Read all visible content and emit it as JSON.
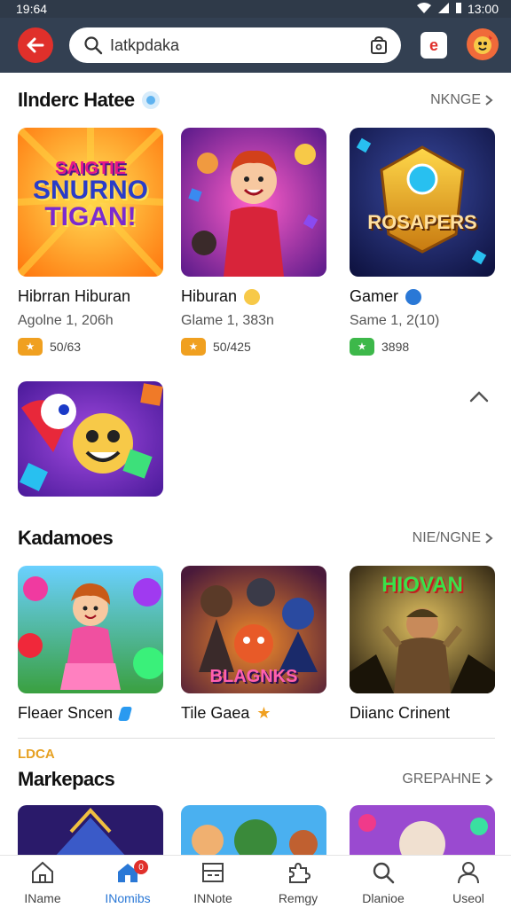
{
  "status_bar": {
    "time_left": "19:64",
    "time_right": "13:00"
  },
  "top_bar": {
    "search_value": "Iatkpdaka",
    "search_placeholder": "Iatkpdaka",
    "notification_label": "e"
  },
  "sections": [
    {
      "title": "Ilnderc Hatee",
      "more_label": "NKNGE",
      "cards": [
        {
          "title": "Hibrran Hiburan",
          "subtitle": "Agolne 1, 206h",
          "badge_text": "50/63",
          "badge_color": "#f0a020",
          "thumb_label_1": "SAIGTIE",
          "thumb_label_2": "SNURNO",
          "thumb_label_3": "TIGAN!"
        },
        {
          "title": "Hiburan",
          "subtitle": "Glame 1, 383n",
          "badge_text": "50/425",
          "badge_color": "#f0a020"
        },
        {
          "title": "Gamer",
          "subtitle": "Same 1, 2(10)",
          "badge_text": "3898",
          "badge_color": "#3db84a",
          "thumb_label_1": "ROSAPERS"
        }
      ]
    },
    {
      "title": "Kadamoes",
      "more_label": "NIE/NGNE",
      "cards": [
        {
          "title": "Fleaer Sncen"
        },
        {
          "title": "Tile Gaea",
          "thumb_label_1": "BLAGNKS"
        },
        {
          "title": "Diianc Crinent",
          "thumb_label_1": "HIOVAN"
        }
      ]
    },
    {
      "tag": "LDCA",
      "title": "Markepacs",
      "more_label": "GREPAHNE"
    }
  ],
  "bottom_nav": [
    {
      "label": "IName",
      "icon": "home-icon"
    },
    {
      "label": "INomibs",
      "icon": "store-icon",
      "badge": "0"
    },
    {
      "label": "INNote",
      "icon": "list-icon"
    },
    {
      "label": "Remgy",
      "icon": "puzzle-icon"
    },
    {
      "label": "Dlanioe",
      "icon": "search-icon"
    },
    {
      "label": "Useol",
      "icon": "user-icon"
    }
  ],
  "colors": {
    "top_bar": "#334052",
    "accent": "#2a78d6",
    "back_button": "#e0302b"
  }
}
